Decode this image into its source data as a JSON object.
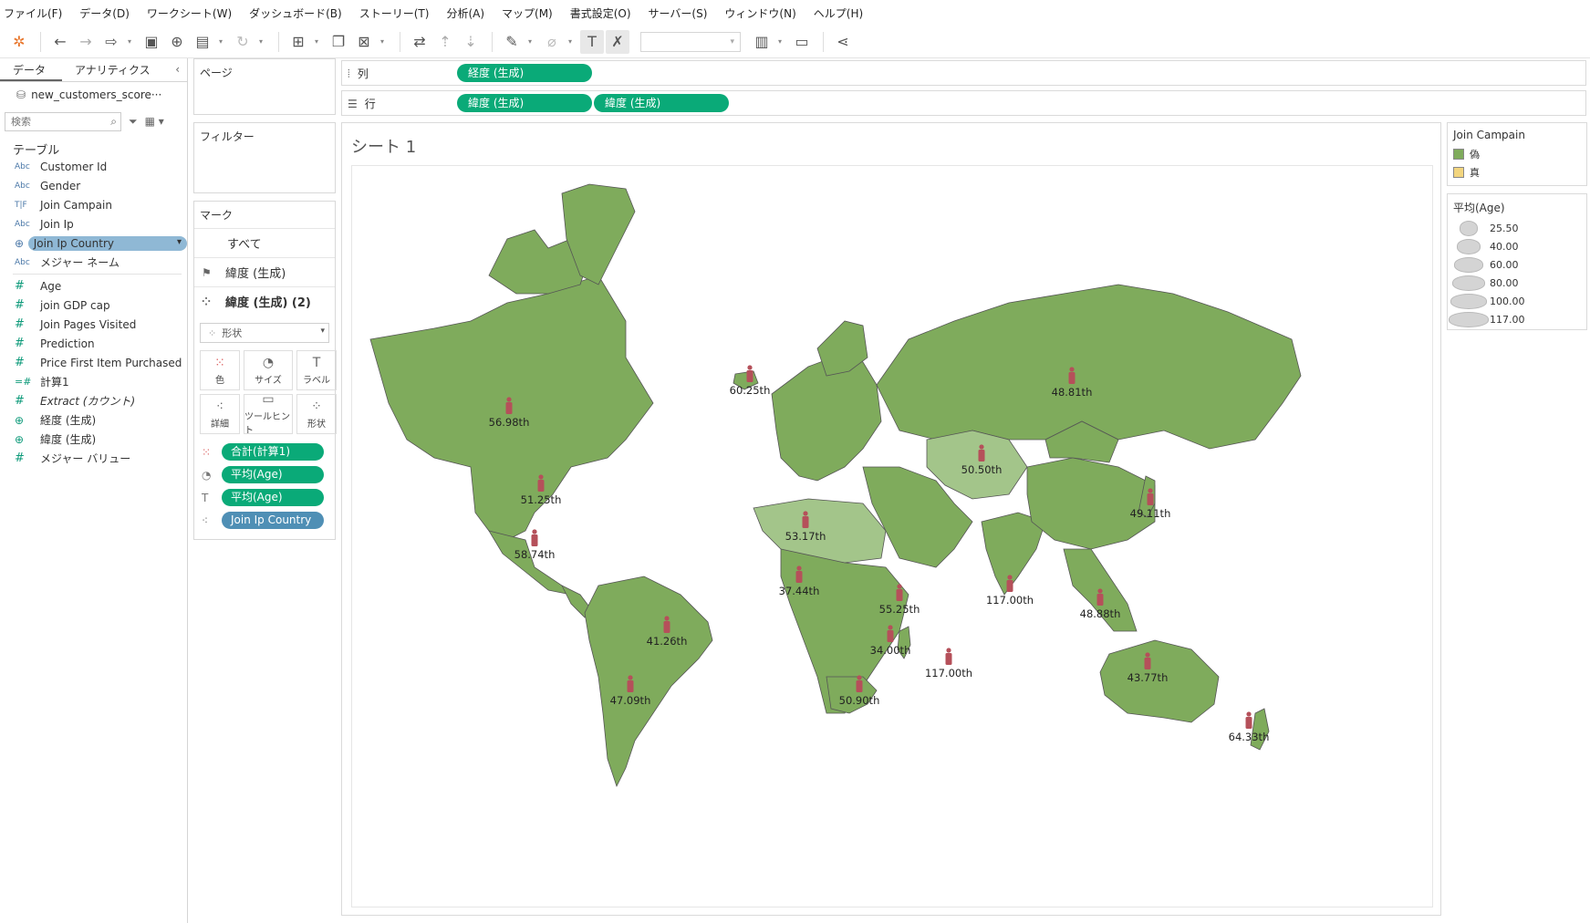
{
  "menu": [
    "ファイル(F)",
    "データ(D)",
    "ワークシート(W)",
    "ダッシュボード(B)",
    "ストーリー(T)",
    "分析(A)",
    "マップ(M)",
    "書式設定(O)",
    "サーバー(S)",
    "ウィンドウ(N)",
    "ヘルプ(H)"
  ],
  "data_pane": {
    "tabs": [
      "データ",
      "アナリティクス"
    ],
    "datasource": "new_customers_score···",
    "search_placeholder": "検索",
    "tables_title": "テーブル",
    "dimensions": [
      {
        "type": "Abc",
        "name": "Customer Id"
      },
      {
        "type": "Abc",
        "name": "Gender"
      },
      {
        "type": "T|F",
        "name": "Join Campain"
      },
      {
        "type": "Abc",
        "name": "Join Ip"
      },
      {
        "type": "geo",
        "name": "Join Ip Country",
        "selected": true
      },
      {
        "type": "Abc",
        "name": "メジャー ネーム"
      }
    ],
    "measures": [
      {
        "type": "#",
        "name": "Age"
      },
      {
        "type": "#",
        "name": "join GDP cap"
      },
      {
        "type": "#",
        "name": "Join Pages Visited"
      },
      {
        "type": "#",
        "name": "Prediction"
      },
      {
        "type": "#",
        "name": "Price First Item Purchased"
      },
      {
        "type": "=#",
        "name": "計算1"
      },
      {
        "type": "#",
        "name": "Extract (カウント)",
        "italic": true
      },
      {
        "type": "geo",
        "name": "経度 (生成)"
      },
      {
        "type": "geo",
        "name": "緯度 (生成)"
      },
      {
        "type": "#",
        "name": "メジャー バリュー"
      }
    ]
  },
  "shelves": {
    "pages": "ページ",
    "filters": "フィルター",
    "columns_label": "列",
    "rows_label": "行",
    "columns_pills": [
      "経度 (生成)"
    ],
    "rows_pills": [
      "緯度 (生成)",
      "緯度 (生成)"
    ]
  },
  "marks": {
    "title": "マーク",
    "all": "すべて",
    "layer1": "緯度 (生成)",
    "layer2": "緯度 (生成) (2)",
    "mark_type": "形状",
    "buttons": [
      "色",
      "サイズ",
      "ラベル",
      "詳細",
      "ツールヒント",
      "形状"
    ],
    "pills": [
      {
        "icon": "color",
        "label": "合計(計算1)",
        "kind": "green"
      },
      {
        "icon": "size",
        "label": "平均(Age)",
        "kind": "green"
      },
      {
        "icon": "label",
        "label": "平均(Age)",
        "kind": "green"
      },
      {
        "icon": "detail",
        "label": "Join Ip Country",
        "kind": "blue"
      }
    ]
  },
  "view": {
    "sheet_title": "シート 1",
    "land_color": "#7fab5c",
    "light_land_color": "#a3c58a",
    "figure_color": "#b5505a",
    "region_labels": [
      {
        "text": "56.98th"
      },
      {
        "text": "51.25th"
      },
      {
        "text": "58.74th"
      },
      {
        "text": "41.26th"
      },
      {
        "text": "47.09th"
      },
      {
        "text": "60.25th"
      },
      {
        "text": "48.81th"
      },
      {
        "text": "50.50th"
      },
      {
        "text": "53.17th"
      },
      {
        "text": "37.44th"
      },
      {
        "text": "55.25th"
      },
      {
        "text": "34.00th"
      },
      {
        "text": "50.90th"
      },
      {
        "text": "117.00th"
      },
      {
        "text": "117.00th"
      },
      {
        "text": "49.11th"
      },
      {
        "text": "48.88th"
      },
      {
        "text": "43.77th"
      },
      {
        "text": "64.33th"
      }
    ]
  },
  "legend_color": {
    "title": "Join Campain",
    "items": [
      {
        "label": "偽",
        "color": "#7fab5c"
      },
      {
        "label": "真",
        "color": "#f2d57e"
      }
    ]
  },
  "legend_size": {
    "title": "平均(Age)",
    "items": [
      "25.50",
      "40.00",
      "60.00",
      "80.00",
      "100.00",
      "117.00"
    ]
  }
}
